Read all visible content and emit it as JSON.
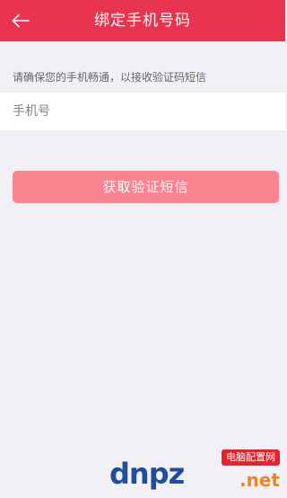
{
  "header": {
    "title": "绑定手机号码",
    "back_icon": "arrow-left-icon"
  },
  "form": {
    "hint": "请确保您的手机畅通，以接收验证码短信",
    "phone_placeholder": "手机号",
    "submit_label": "获取验证短信"
  },
  "watermark": {
    "letters": "dnpz",
    "badge": "电脑配置网",
    "domain": ".net"
  },
  "colors": {
    "header_bg": "#e8344e",
    "button_bg": "#f9838f",
    "page_bg": "#f2f0f4"
  }
}
